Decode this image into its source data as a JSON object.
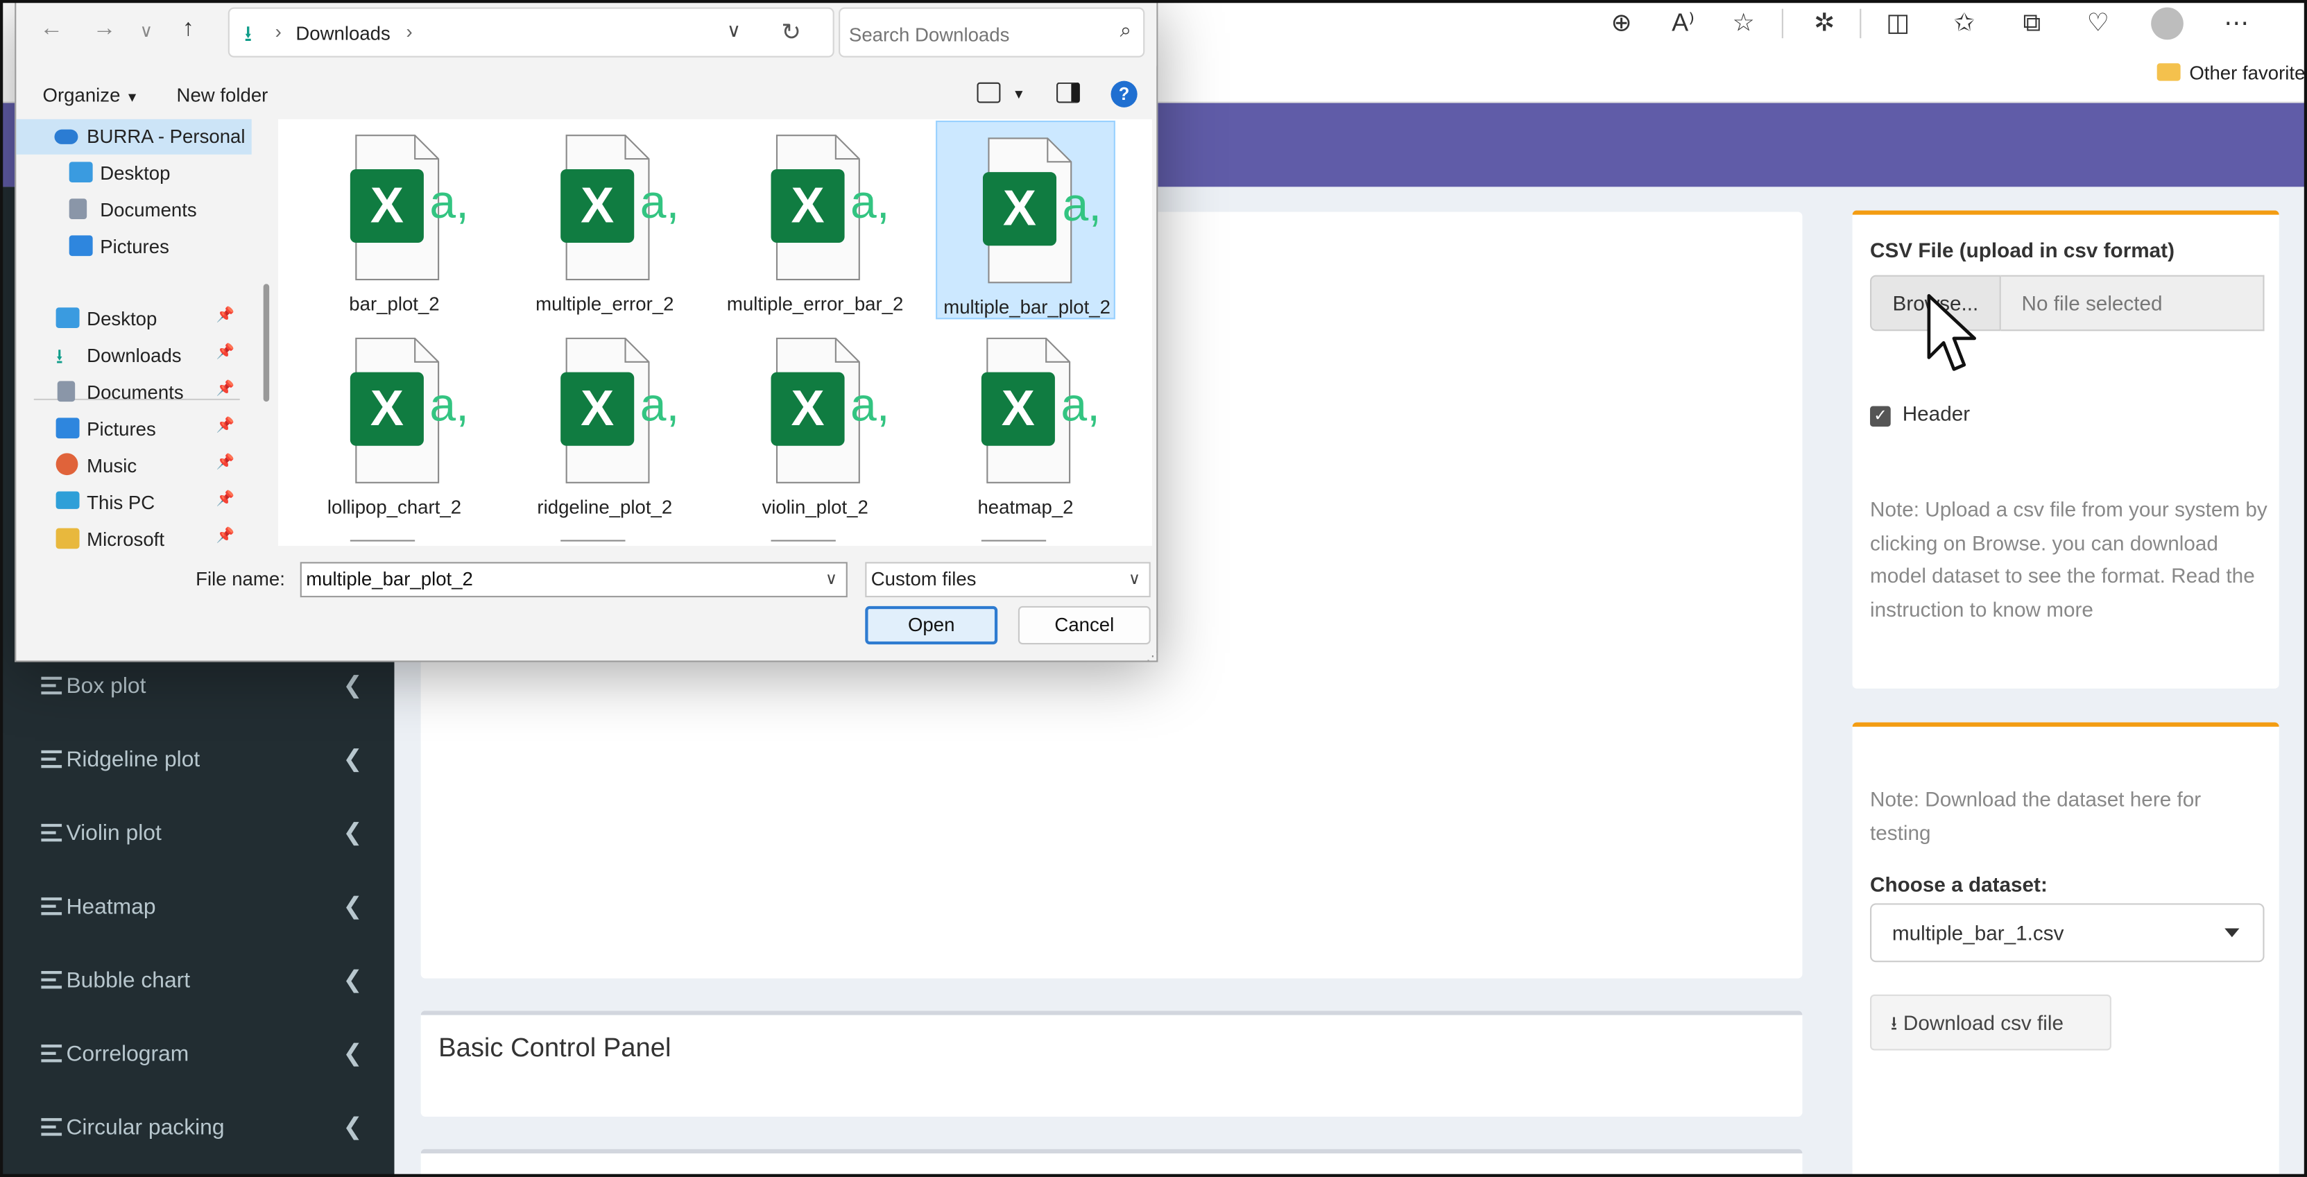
{
  "browser": {
    "toolbar_icons": [
      "zoom-icon",
      "read-aloud-icon",
      "favorite-star-icon",
      "extensions-icon",
      "split-screen-icon",
      "favorites-icon",
      "collections-icon",
      "health-icon",
      "profile-icon",
      "more-icon"
    ],
    "favorites_bar": {
      "other_favorites": "Other favorite"
    }
  },
  "sidebar": {
    "items": [
      {
        "label": "Box plot"
      },
      {
        "label": "Ridgeline plot"
      },
      {
        "label": "Violin plot"
      },
      {
        "label": "Heatmap"
      },
      {
        "label": "Bubble chart"
      },
      {
        "label": "Correlogram"
      },
      {
        "label": "Circular packing"
      }
    ]
  },
  "main": {
    "control_panel_title": "Basic Control Panel"
  },
  "upload_box": {
    "label": "CSV File (upload in csv format)",
    "browse_label": "Browse...",
    "file_placeholder": "No file selected",
    "header_checkbox_label": "Header",
    "header_checked": true,
    "note": "Note: Upload a csv file from your system by clicking on Browse. you can download model dataset to see the format. Read the instruction to know more"
  },
  "dataset_box": {
    "note": "Note: Download the dataset here for testing",
    "choose_label": "Choose a dataset:",
    "selected_dataset": "multiple_bar_1.csv",
    "download_label": "Download csv file"
  },
  "dialog": {
    "breadcrumb": [
      "Downloads"
    ],
    "search_placeholder": "Search Downloads",
    "organize_label": "Organize",
    "new_folder_label": "New folder",
    "help_label": "?",
    "nav_items": [
      {
        "label": "BURRA - Personal",
        "icon": "onedrive-icon",
        "selected": true
      },
      {
        "label": "Desktop",
        "icon": "desktop-icon"
      },
      {
        "label": "Documents",
        "icon": "documents-icon"
      },
      {
        "label": "Pictures",
        "icon": "pictures-icon"
      },
      {
        "label": "Desktop",
        "icon": "desktop-icon",
        "pinned": true
      },
      {
        "label": "Downloads",
        "icon": "downloads-icon",
        "pinned": true
      },
      {
        "label": "Documents",
        "icon": "documents-icon",
        "pinned": true
      },
      {
        "label": "Pictures",
        "icon": "pictures-icon",
        "pinned": true
      },
      {
        "label": "Music",
        "icon": "music-icon",
        "pinned": true
      },
      {
        "label": "This PC",
        "icon": "this-pc-icon",
        "pinned": true
      },
      {
        "label": "Microsoft",
        "icon": "folder-icon",
        "pinned": true
      }
    ],
    "files": [
      {
        "name": "bar_plot_2"
      },
      {
        "name": "multiple_error_2"
      },
      {
        "name": "multiple_error_bar_2"
      },
      {
        "name": "multiple_bar_plot_2",
        "selected": true
      },
      {
        "name": "lollipop_chart_2"
      },
      {
        "name": "ridgeline_plot_2"
      },
      {
        "name": "violin_plot_2"
      },
      {
        "name": "heatmap_2"
      }
    ],
    "file_name_label": "File name:",
    "file_name_value": "multiple_bar_plot_2",
    "file_type": "Custom files",
    "open_label": "Open",
    "cancel_label": "Cancel"
  },
  "colors": {
    "header": "#605ca8",
    "sidebar": "#222d32",
    "box_accent": "#f39c12",
    "excel_green": "#107c41",
    "selection": "#cce8ff"
  }
}
